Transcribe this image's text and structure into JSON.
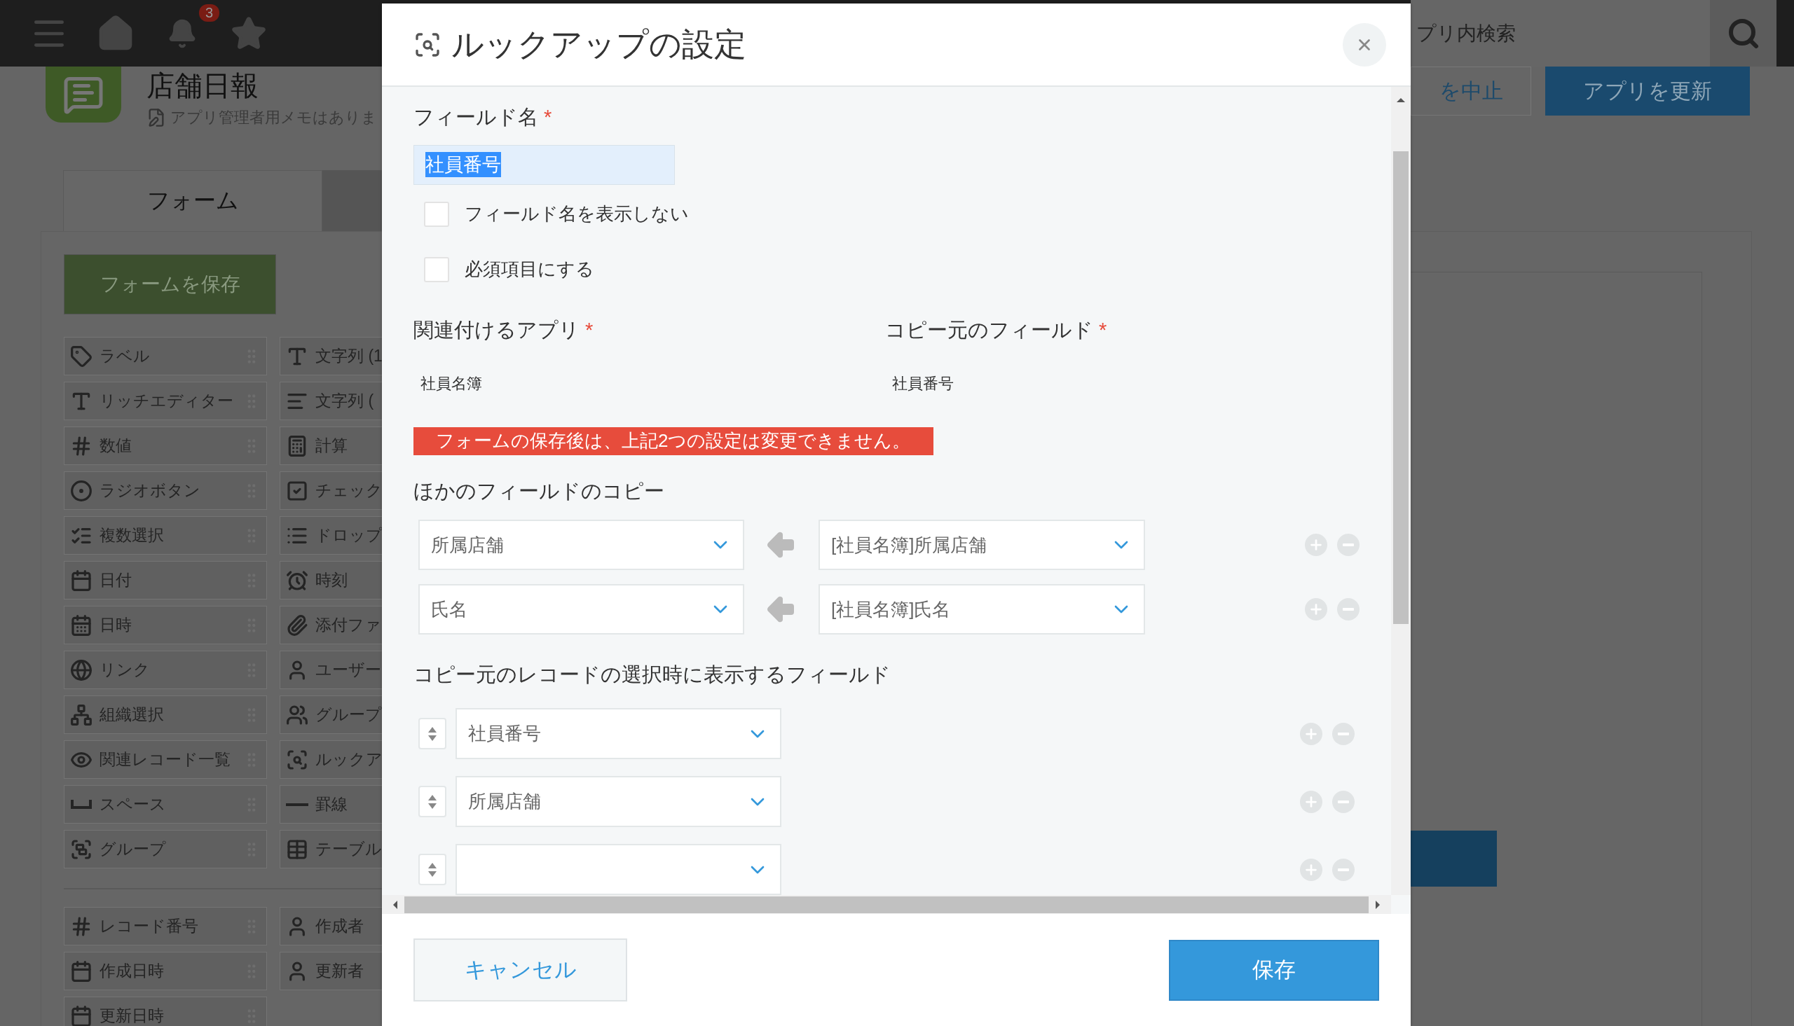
{
  "top_bar": {
    "notification_count": "3",
    "search": {
      "placeholder": "プリ内検索"
    }
  },
  "app": {
    "title": "店舗日報",
    "memo": "アプリ管理者用メモはありま",
    "buttons": [
      {
        "label": "を中止",
        "kind": "secondary"
      },
      {
        "label": "アプリを更新",
        "kind": "primary"
      }
    ]
  },
  "tabs": [
    {
      "label": "フォーム",
      "selected": true
    }
  ],
  "save_form_button": "フォームを保存",
  "palette": {
    "fields": [
      "ラベル",
      "文字列 (1",
      "リッチエディター",
      "文字列 (",
      "数値",
      "計算",
      "ラジオボタン",
      "チェック",
      "複数選択",
      "ドロップ",
      "日付",
      "時刻",
      "日時",
      "添付ファ",
      "リンク",
      "ユーザー",
      "組織選択",
      "グループ",
      "関連レコード一覧",
      "ルックア",
      "スペース",
      "罫線",
      "グループ",
      "テーブル"
    ],
    "system_fields": [
      "レコード番号",
      "作成者",
      "作成日時",
      "更新者",
      "更新日時"
    ]
  },
  "dialog": {
    "title": "ルックアップの設定",
    "field_name": {
      "label": "フィールド名",
      "required_mark": "*",
      "value": "社員番号"
    },
    "options": [
      {
        "label": "フィールド名を表示しない",
        "checked": false
      },
      {
        "label": "必須項目にする",
        "checked": false
      }
    ],
    "related_app": {
      "label": "関連付けるアプリ",
      "required_mark": "*",
      "value": "社員名簿"
    },
    "source_field": {
      "label": "コピー元のフィールド",
      "required_mark": "*",
      "value": "社員番号"
    },
    "warning": "フォームの保存後は、上記2つの設定は変更できません。",
    "copy_section": {
      "heading": "ほかのフィールドのコピー",
      "mappings": [
        {
          "target": "所属店舗",
          "source": "[社員名簿]所属店舗"
        },
        {
          "target": "氏名",
          "source": "[社員名簿]氏名"
        }
      ]
    },
    "display_section": {
      "heading": "コピー元のレコードの選択時に表示するフィールド",
      "fields": [
        "社員番号",
        "所属店舗"
      ]
    },
    "buttons": {
      "cancel": "キャンセル",
      "save": "保存"
    }
  }
}
